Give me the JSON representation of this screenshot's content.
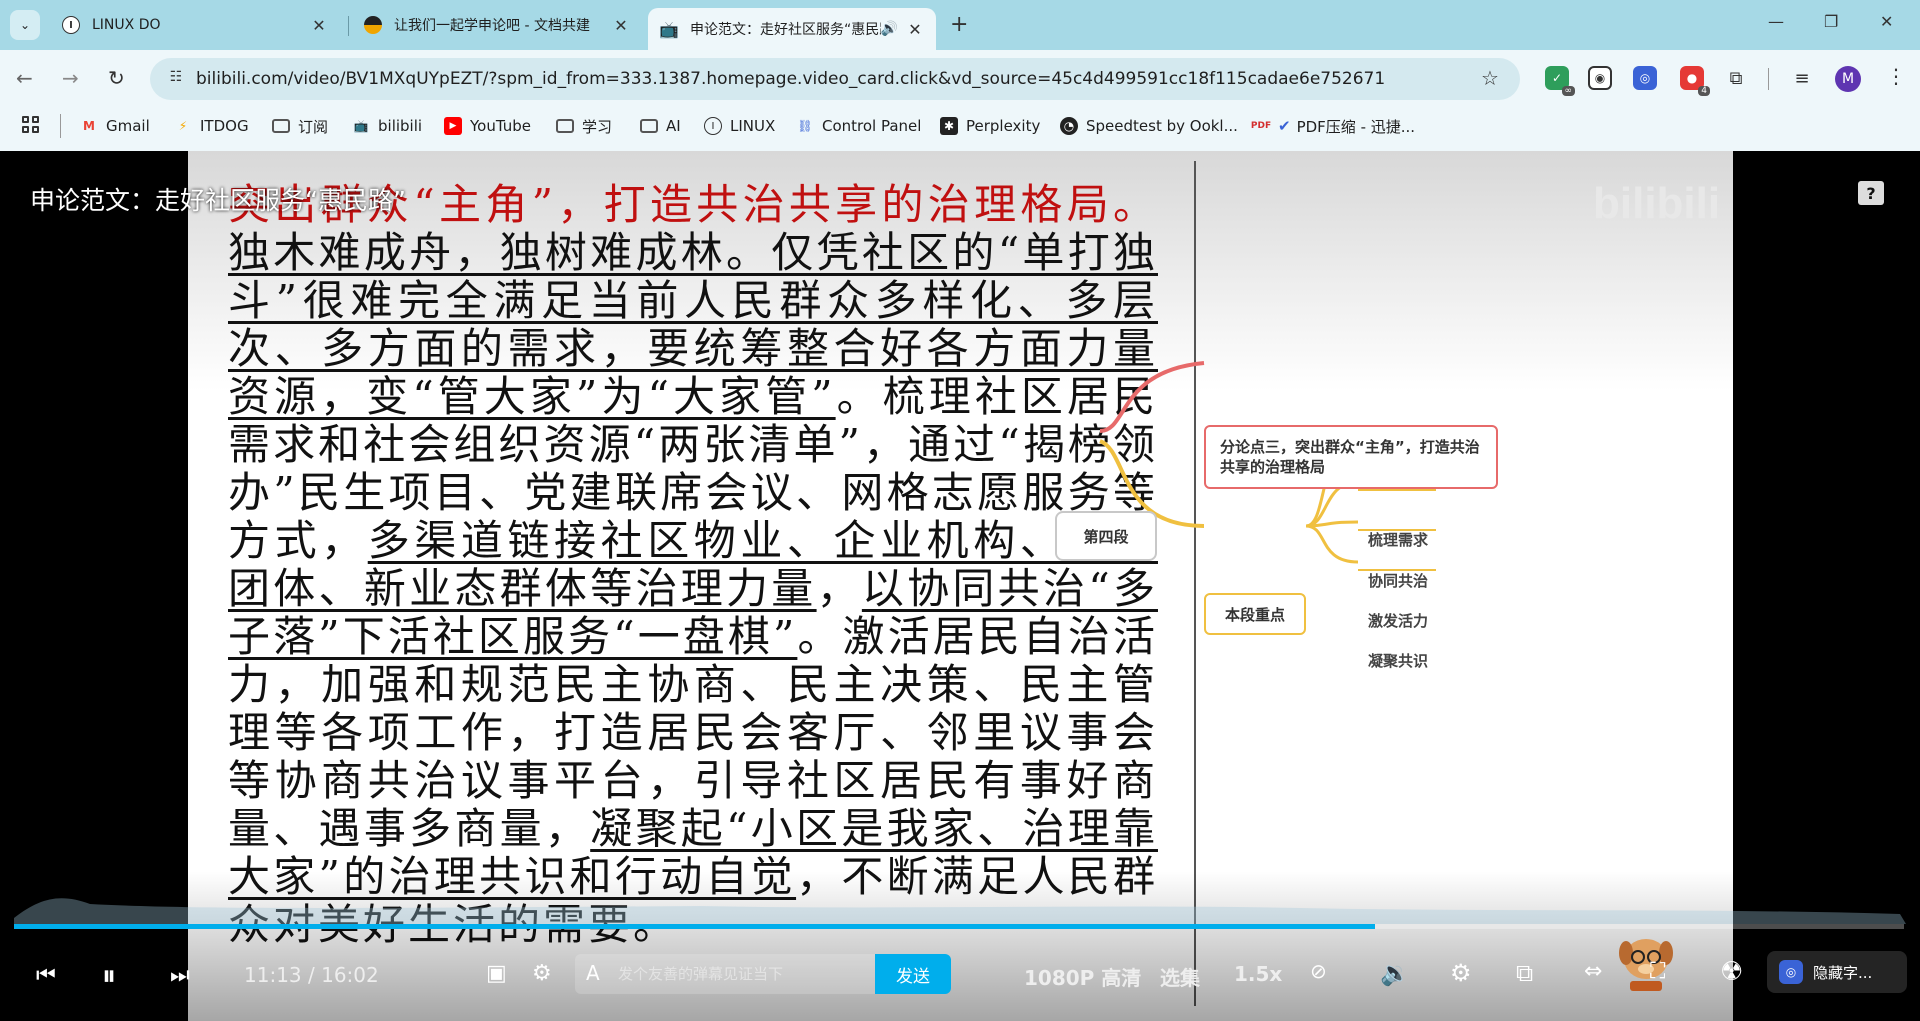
{
  "browser": {
    "tabs": [
      {
        "title": "LINUX DO",
        "favicon": "linuxdo-icon",
        "active": false
      },
      {
        "title": "让我们一起学申论吧 - 文档共建",
        "favicon": "linuxdo-icon",
        "active": false
      },
      {
        "title": "申论范文：走好社区服务“惠民路”",
        "favicon": "bilibili-icon",
        "active": true
      }
    ],
    "url": "bilibili.com/video/BV1MXqUYpEZT/?spm_id_from=333.1387.homepage.video_card.click&vd_source=45c4d499591cc18f115cadae6e752671",
    "profile_initial": "M",
    "extension_badges": {
      "ext1": "∞",
      "ext4": "4"
    },
    "bookmarks": [
      {
        "label": "Gmail",
        "icon": "gmail-icon"
      },
      {
        "label": "ITDOG",
        "icon": "itdog-icon"
      },
      {
        "label": "订阅",
        "icon": "folder-icon"
      },
      {
        "label": "bilibili",
        "icon": "bilibili-icon"
      },
      {
        "label": "YouTube",
        "icon": "youtube-icon"
      },
      {
        "label": "学习",
        "icon": "folder-icon"
      },
      {
        "label": "AI",
        "icon": "folder-icon"
      },
      {
        "label": "LINUX",
        "icon": "linuxdo-icon"
      },
      {
        "label": "Control Panel",
        "icon": "control-panel-icon"
      },
      {
        "label": "Perplexity",
        "icon": "perplexity-icon"
      },
      {
        "label": "Speedtest by Ookl...",
        "icon": "speedtest-icon"
      },
      {
        "label": "PDF压缩 - 迅捷...",
        "icon": "pdf-icon"
      }
    ]
  },
  "video": {
    "title": "申论范文：走好社区服务“惠民路”",
    "slide": {
      "heading_red": "突出群众“主角”，打造共治共享的治理格局。",
      "segments": [
        {
          "text": "独木难成舟，独树难成林。仅凭社区的“单打独斗”很难完全满足当前人民群众多样化、多层次、多方面的需求，要统筹整合好各方面力量资源，变“管大家”为“大家管”",
          "underline": true
        },
        {
          "text": "。梳理社区居民需求和社会组织资源“两张清单”，通过“揭榜领办”民生项目、党建联席会议、网格志愿服务等方式，",
          "underline": false
        },
        {
          "text": "多渠道链接社区物业、企业机构、志愿团体、新业态群体等治理力量",
          "underline": true
        },
        {
          "text": "，",
          "underline": false
        },
        {
          "text": "以协同共治“多子落”下活社区服务“一盘棋”",
          "underline": true
        },
        {
          "text": "。激活居民自治活力，加强和规范民主协商、民主决策、民主管理等各项工作，打造居民会客厅、邻里议事会等协商共治议事平台，引导社区居民有事好商量、遇事多商量，",
          "underline": false
        },
        {
          "text": "凝聚起“小区是我家、治理靠大家”的治理共识和行动自觉",
          "underline": true
        },
        {
          "text": "，不断满足人民群众对美好生活的需要。",
          "underline": false
        }
      ],
      "mindmap": {
        "root": "第四段",
        "branch_red": "分论点三，突出群众“主角”，打造共治共享的治理格局",
        "branch_yellow": "本段重点",
        "leaves": [
          "梳理需求",
          "协同共治",
          "激发活力",
          "凝聚共识"
        ]
      }
    },
    "player": {
      "progress_fraction": 0.72,
      "time_display": "11:13 / 16:02",
      "danmaku_placeholder": "发个友善的弹幕见证当下",
      "send_label": "发送",
      "quality_label": "1080P 高清",
      "episodes_label": "选集",
      "speed_label": "1.5x",
      "hide_subtitle_label": "隐藏字..."
    }
  }
}
